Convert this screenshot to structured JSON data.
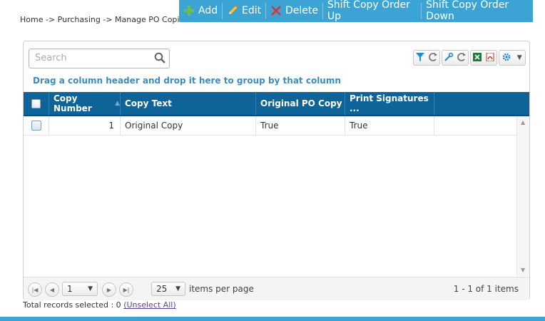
{
  "breadcrumb": "Home -> Purchasing -> Manage PO Copies",
  "toolbar": {
    "add_label": "Add",
    "edit_label": "Edit",
    "delete_label": "Delete",
    "shift_up_label": "Shift Copy Order Up",
    "shift_down_label": "Shift Copy Order Down"
  },
  "search": {
    "placeholder": "Search"
  },
  "group_hint": "Drag a column header and drop it here to group by that column",
  "grid": {
    "columns": [
      "Copy Number",
      "Copy Text",
      "Original PO Copy",
      "Print Signatures ..."
    ],
    "rows": [
      {
        "copy_number": "1",
        "copy_text": "Original Copy",
        "original_po_copy": "True",
        "print_signatures": "True"
      }
    ]
  },
  "pager": {
    "page": "1",
    "page_size": "25",
    "items_per_page_label": "items per page",
    "info": "1 - 1 of 1 items"
  },
  "footer": {
    "selected_text": "Total records selected : 0",
    "unselect_label": "(Unselect All)"
  },
  "colors": {
    "accent": "#3ba4d4",
    "header": "#0e6498"
  },
  "icons": [
    "plus-icon",
    "pencil-icon",
    "x-icon",
    "search-icon",
    "filter-icon",
    "refresh-icon",
    "wrench-icon",
    "excel-icon",
    "pdf-icon",
    "gear-icon"
  ]
}
